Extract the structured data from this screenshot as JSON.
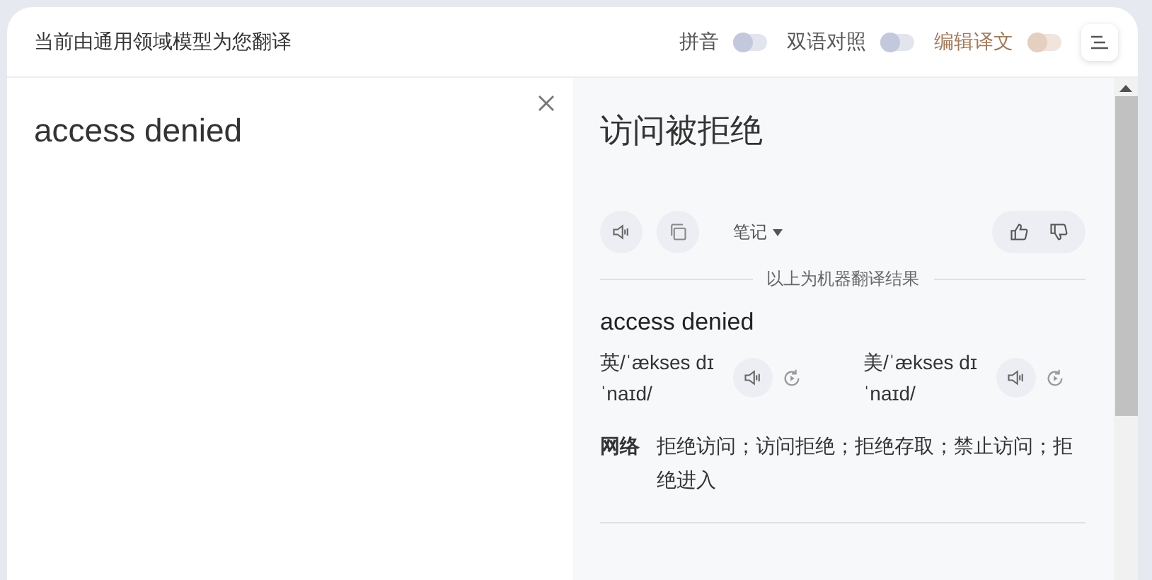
{
  "header": {
    "title": "当前由通用领域模型为您翻译",
    "toggles": [
      {
        "label": "拼音",
        "on": false,
        "highlighted": false
      },
      {
        "label": "双语对照",
        "on": false,
        "highlighted": false
      },
      {
        "label": "编辑译文",
        "on": false,
        "highlighted": true
      }
    ]
  },
  "source": {
    "text": "access denied"
  },
  "result": {
    "translation": "访问被拒绝",
    "note_label": "笔记",
    "divider_label": "以上为机器翻译结果",
    "word": "access denied",
    "pronunciations": [
      {
        "text": "英/ˈækses dɪˈnaɪd/"
      },
      {
        "text": "美/ˈækses dɪˈnaɪd/"
      }
    ],
    "web": {
      "label": "网络",
      "text": "拒绝访问；访问拒绝；拒绝存取；禁止访问；拒绝进入"
    }
  }
}
